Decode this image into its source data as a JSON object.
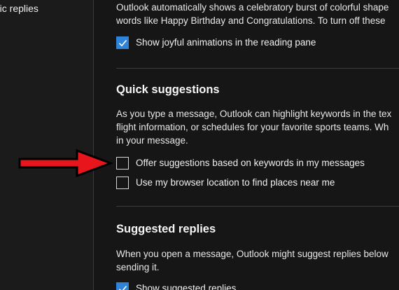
{
  "sidebar": {
    "items": [
      {
        "label": "atic replies"
      }
    ]
  },
  "joyful": {
    "description_lines": [
      "Outlook automatically shows a celebratory burst of colorful shape",
      "words like Happy Birthday and Congratulations. To turn off these"
    ],
    "checkbox_label": "Show joyful animations in the reading pane",
    "checked": true
  },
  "quick_suggestions": {
    "heading": "Quick suggestions",
    "description_lines": [
      "As you type a message, Outlook can highlight keywords in the tex",
      "flight information, or schedules for your favorite sports teams. Wh",
      "in your message."
    ],
    "options": [
      {
        "label": "Offer suggestions based on keywords in my messages",
        "checked": false
      },
      {
        "label": "Use my browser location to find places near me",
        "checked": false
      }
    ]
  },
  "suggested_replies": {
    "heading": "Suggested replies",
    "description_lines": [
      "When you open a message, Outlook might suggest replies below",
      "sending it."
    ],
    "checkbox_label": "Show suggested replies",
    "checked": true
  },
  "colors": {
    "accent": "#2f84d7",
    "annotation_arrow": "#e8161c"
  }
}
